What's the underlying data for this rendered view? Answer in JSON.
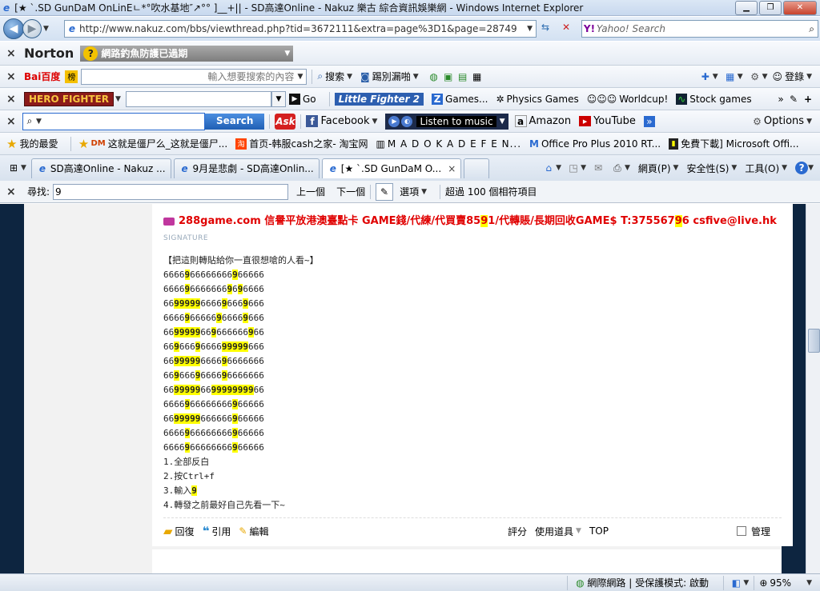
{
  "window": {
    "title": "[★ ˋ.SD GunDaM OnLinEㄴ*°吹水基地″↗°° ]__+|| - SD高達Online - Nakuz 樂古 綜合資訊娛樂網 - Windows Internet Explorer"
  },
  "address": {
    "url": "http://www.nakuz.com/bbs/viewthread.php?tid=3672111&extra=page%3D1&page=28749",
    "search_placeholder": "Yahoo! Search"
  },
  "norton": {
    "brand": "Norton",
    "alert": "網路釣魚防護已過期"
  },
  "baidu": {
    "brand": "Bai百度",
    "input_placeholder": "輸入想要搜索的內容",
    "search": "搜索",
    "news": "踢別漏啪",
    "login": "登錄"
  },
  "hero": {
    "brand": "HERO FIGHTER",
    "go": "Go",
    "lf2": "Little Fighter 2",
    "games": "Games...",
    "physics": "Physics Games",
    "worldcup": "Worldcup!",
    "stock": "Stock games"
  },
  "ask": {
    "search": "Search",
    "brand": "Ask",
    "facebook": "Facebook",
    "music": "Listen to music",
    "amazon": "Amazon",
    "youtube": "YouTube",
    "options": "Options"
  },
  "favorites": {
    "label": "我的最愛",
    "items": [
      "这就是僵尸么_这就是僵尸...",
      "首页-韩服cash之家- 淘宝网",
      "M A D O K A  D E F E N...",
      "Office Pro Plus 2010 RT...",
      "免費下載] Microsoft Offi..."
    ]
  },
  "tabs": {
    "items": [
      "SD高達Online - Nakuz ...",
      "9月是悲劇 - SD高達Onlin...",
      "[★ ˋ.SD GunDaM O..."
    ],
    "cmd": {
      "page": "網頁(P)",
      "safety": "安全性(S)",
      "tools": "工具(O)"
    }
  },
  "find": {
    "label": "尋找:",
    "value": "9",
    "prev": "上一個",
    "next": "下一個",
    "options": "選項",
    "result": "超過 100 個相符項目"
  },
  "post": {
    "signature": "288game.com 信譽平放港澳臺點卡 GAME錢/代練/代買賣8591/代轉賬/長期回收GAME$ T:37556796 csfive@live.hk",
    "signature_label": "SIGNATURE",
    "lines": [
      "【把這則轉貼給你一直很想嗆的人看~】",
      "6666966666666966666",
      "6666966666669696666",
      "6699999666696669666",
      "6666966666966669666",
      "6699999669666666966",
      "6696669666699999666",
      "6699999666696666666",
      "6696669666696666666",
      "6699999669999999966",
      "6666966666666966666",
      "6699999666666966666",
      "6666966666666966666",
      "6666966666666966666",
      "1.全部反白",
      "2.按Ctrl+f",
      "3.輸入9",
      "4.轉發之前最好自己先看一下~"
    ],
    "actions": {
      "reply": "回復",
      "quote": "引用",
      "edit": "編輯",
      "rate": "評分",
      "use_tool": "使用道具",
      "top": "TOP",
      "manage": "管理"
    }
  },
  "status": {
    "zone": "網際網路 | 受保護模式: 啟動",
    "zoom": "95%"
  },
  "colors": {
    "highlight": "#ffff00",
    "signature": "#e00000",
    "page_bg": "#0d2540"
  }
}
